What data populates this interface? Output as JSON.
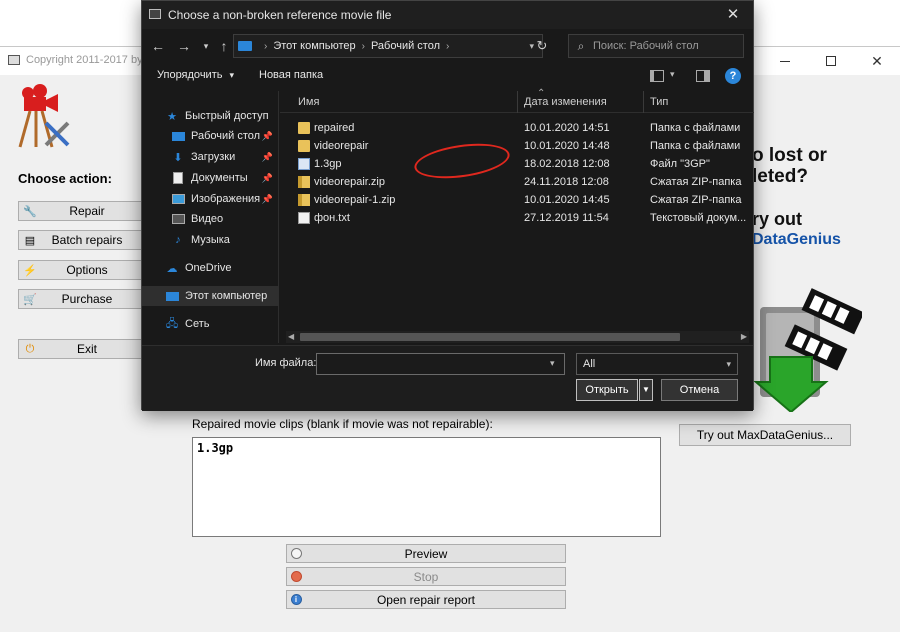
{
  "app": {
    "title": "Copyright 2011-2017 by",
    "choose_label": "Choose action:",
    "buttons": {
      "repair": "Repair",
      "batch": "Batch repairs",
      "options": "Options",
      "purchase": "Purchase",
      "exit": "Exit"
    },
    "promo": {
      "line1": "o lost or",
      "line2": "leted?",
      "try": "ry out",
      "brand": "DataGenius",
      "tryout_button": "Try out MaxDataGenius..."
    },
    "repaired_label": "Repaired movie clips (blank if movie was not repairable):",
    "repaired_value": "1.3gp",
    "bottom_buttons": {
      "preview": "Preview",
      "stop": "Stop",
      "report": "Open repair report"
    }
  },
  "dialog": {
    "title": "Choose a non-broken reference movie file",
    "address": [
      "Этот компьютер",
      "Рабочий стол"
    ],
    "search_placeholder": "Поиск: Рабочий стол",
    "toolbar": {
      "organize": "Упорядочить",
      "new_folder": "Новая папка"
    },
    "nav": [
      {
        "label": "Быстрый доступ",
        "icon": "star-icon"
      },
      {
        "label": "Рабочий стол",
        "icon": "desktop-icon",
        "pinned": true
      },
      {
        "label": "Загрузки",
        "icon": "download-icon",
        "pinned": true
      },
      {
        "label": "Документы",
        "icon": "documents-icon",
        "pinned": true
      },
      {
        "label": "Изображения",
        "icon": "pictures-icon",
        "pinned": true
      },
      {
        "label": "Видео",
        "icon": "video-icon"
      },
      {
        "label": "Музыка",
        "icon": "music-icon"
      },
      {
        "label": "OneDrive",
        "icon": "cloud-icon"
      },
      {
        "label": "Этот компьютер",
        "icon": "computer-icon",
        "selected": true
      },
      {
        "label": "Сеть",
        "icon": "network-icon"
      }
    ],
    "columns": {
      "name": "Имя",
      "date": "Дата изменения",
      "type": "Тип"
    },
    "files": [
      {
        "name": "repaired",
        "date": "10.01.2020 14:51",
        "type": "Папка с файлами",
        "icon": "folder-icon"
      },
      {
        "name": "videorepair",
        "date": "10.01.2020 14:48",
        "type": "Папка с файлами",
        "icon": "folder-icon"
      },
      {
        "name": "1.3gp",
        "date": "18.02.2018 12:08",
        "type": "Файл \"3GP\"",
        "icon": "video-file-icon"
      },
      {
        "name": "videorepair.zip",
        "date": "24.11.2018 12:08",
        "type": "Сжатая ZIP-папка",
        "icon": "zip-icon"
      },
      {
        "name": "videorepair-1.zip",
        "date": "10.01.2020 14:45",
        "type": "Сжатая ZIP-папка",
        "icon": "zip-icon"
      },
      {
        "name": "фон.txt",
        "date": "27.12.2019 11:54",
        "type": "Текстовый докум...",
        "icon": "text-file-icon"
      }
    ],
    "filename_label": "Имя файла:",
    "filename_value": "",
    "filter_value": "All",
    "open_button": "Открыть",
    "cancel_button": "Отмена"
  }
}
